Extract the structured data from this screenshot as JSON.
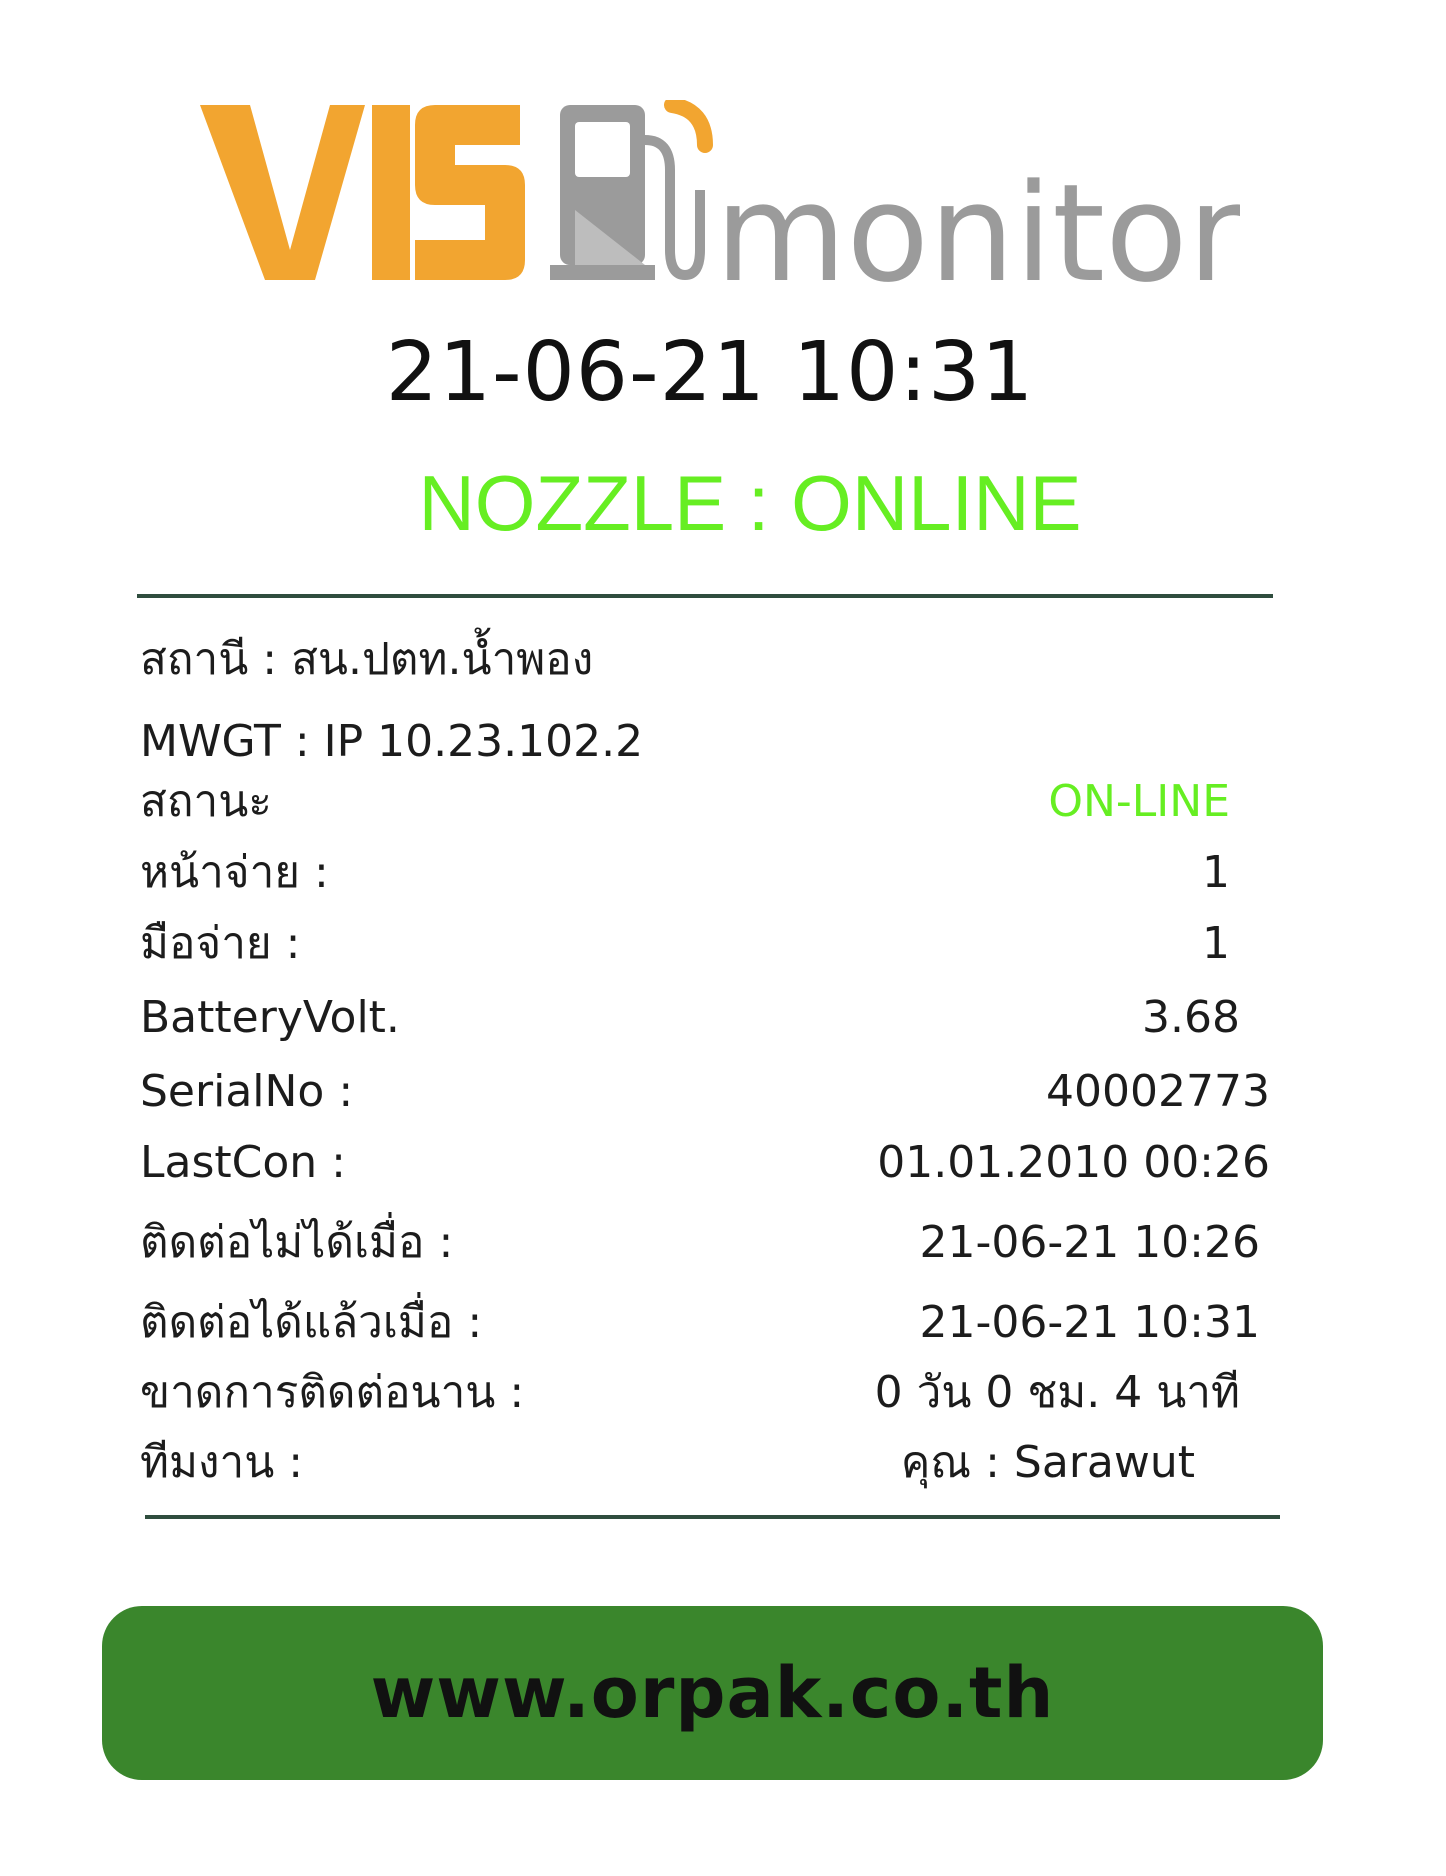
{
  "logo": {
    "brand_text": "VIS",
    "product_text": "monitor",
    "colors": {
      "brand": "#f2a530",
      "product": "#9b9b9b"
    },
    "icon": "fuel-pump-icon"
  },
  "header": {
    "datetime": "21-06-21  10:31",
    "nozzle_status": "NOZZLE : ONLINE",
    "status_color": "#66ee22"
  },
  "info": {
    "station": "สถานี : สน.ปตท.น้ำพอง",
    "mwgt": "MWGT : IP 10.23.102.2",
    "rows": [
      {
        "label": "สถานะ",
        "value": "ON-LINE"
      },
      {
        "label": "หน้าจ่าย :",
        "value": "1"
      },
      {
        "label": "มือจ่าย :",
        "value": "1"
      },
      {
        "label": "BatteryVolt.",
        "value": "3.68"
      },
      {
        "label": "SerialNo :",
        "value": "40002773"
      },
      {
        "label": "LastCon :",
        "value": "01.01.2010 00:26"
      },
      {
        "label": "ติดต่อไม่ได้เมื่อ :",
        "value": "21-06-21  10:26"
      },
      {
        "label": "ติดต่อได้แล้วเมื่อ :",
        "value": "21-06-21  10:31"
      },
      {
        "label": "ขาดการติดต่อนาน :",
        "value": "0 วัน 0 ชม. 4 นาที"
      },
      {
        "label": "ทีมงาน :",
        "value": "คุณ : Sarawut"
      }
    ]
  },
  "footer": {
    "website": "www.orpak.co.th",
    "button_color": "#3a862c"
  }
}
